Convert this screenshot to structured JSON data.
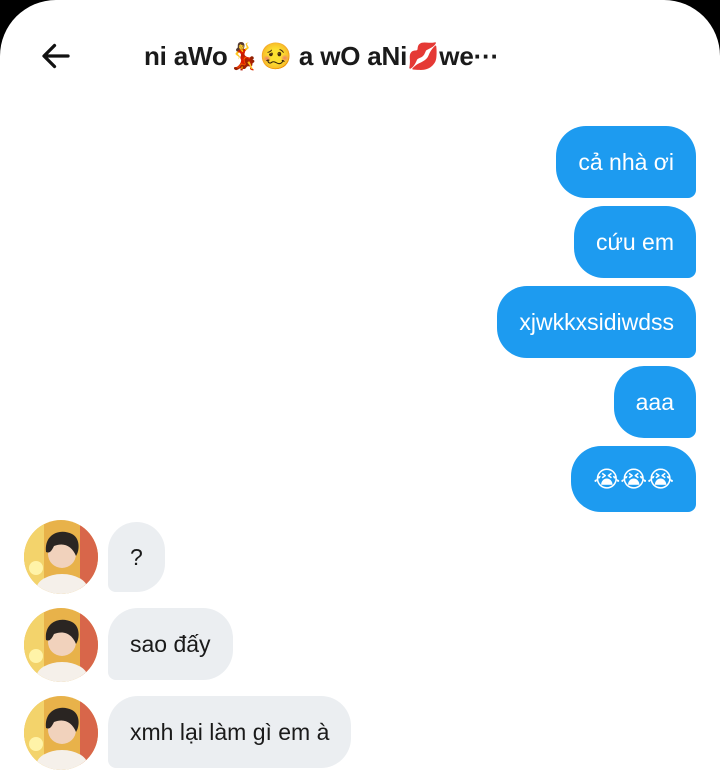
{
  "header": {
    "title": "ni aWo💃🥴 a wO aNi💋we···"
  },
  "messages": {
    "outgoing": [
      {
        "text": "cả nhà ơi"
      },
      {
        "text": "cứu em"
      },
      {
        "text": "xjwkkxsidiwdss"
      },
      {
        "text": "aaa"
      },
      {
        "text": "😭😭😭"
      }
    ],
    "incoming": [
      {
        "text": "?"
      },
      {
        "text": "sao đấy"
      },
      {
        "text": "xmh lại làm gì em à"
      }
    ]
  },
  "colors": {
    "outgoing_bubble": "#1d9bf0",
    "incoming_bubble": "#ebeef1",
    "text_dark": "#1a1a1a"
  },
  "icons": {
    "back": "arrow-left-icon",
    "avatar": "profile-photo"
  }
}
